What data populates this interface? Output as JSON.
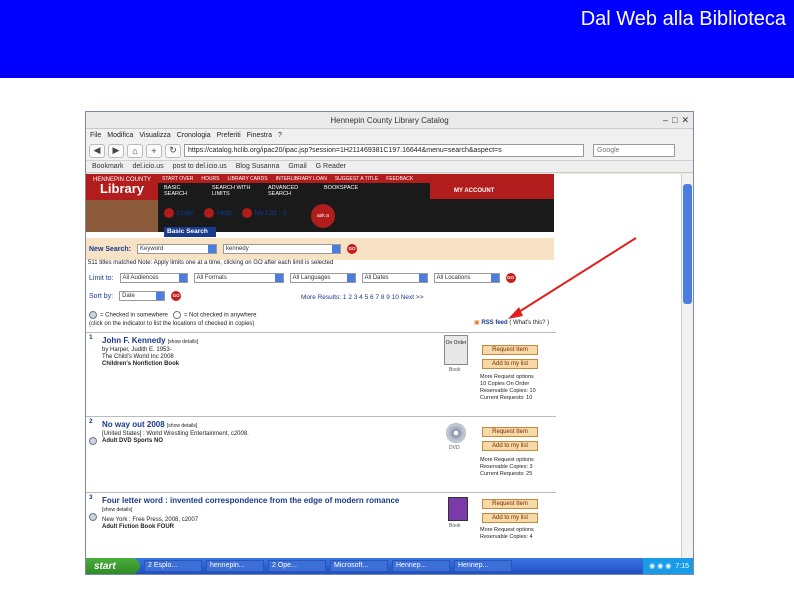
{
  "slide": {
    "title": "Dal Web alla Biblioteca"
  },
  "browser": {
    "window_title": "Hennepin County Library Catalog",
    "menu": [
      "File",
      "Modifica",
      "Visualizza",
      "Cronologia",
      "Preferiti",
      "Finestra",
      "?"
    ],
    "url": "https://catalog.hclib.org/ipac20/ipac.jsp?session=1H211469381C197.16644&menu=search&aspect=s",
    "search_placeholder": "Google",
    "bookmarks": [
      "Bookmark",
      "del.icio.us",
      "post to del.icio.us",
      "Blog Susanna",
      "Gmail",
      "G Reader"
    ]
  },
  "library": {
    "logo_top": "HENNEPIN COUNTY",
    "logo_name": "Library",
    "top_links": [
      "START OVER",
      "HOURS",
      "LIBRARY CARDS",
      "INTERLIBRARY LOAN",
      "SUGGEST A TITLE",
      "FEEDBACK"
    ],
    "main_nav": [
      "BASIC SEARCH",
      "SEARCH WITH LIMITS",
      "ADVANCED SEARCH",
      "BOOKSPACE"
    ],
    "account": "MY ACCOUNT",
    "login": "Login",
    "help": "Help",
    "mylist": "My List - 0",
    "ask": "ask a librarian",
    "basic_search": "Basic Search",
    "new_search_label": "New Search:",
    "search_type": "Keyword",
    "search_value": "kennedy",
    "go": "GO",
    "matched": "511 titles matched Note: Apply limits one at a time, clicking on GO after each limit is selected",
    "limit_label": "Limit to:",
    "limits": [
      "All Audiences",
      "All Formats",
      "All Languages",
      "All Dates",
      "All Locations"
    ],
    "sort_label": "Sort by:",
    "sort_value": "Date",
    "more_results": "More Results: 1 2 3 4 5 6 7 8 9 10 Next >>",
    "legend_1": "= Checked in somewhere",
    "legend_2": "= Not checked in anywhere",
    "legend_note": "(click on the indicator to list the locations of checked in copies)",
    "rss": "RSS feed",
    "rss_link": "( What's this? )"
  },
  "results": [
    {
      "num": "1",
      "title": "John F. Kennedy",
      "details": "[show details]",
      "meta": [
        "by Harper, Judith E. 1953-",
        "The Child's World Inc 2008"
      ],
      "collection": "Children's Nonfiction Book",
      "icon": "On Order",
      "icon_label": "Book",
      "request": "Request Item",
      "add": "Add to my list",
      "side": [
        "More Request options",
        "10 Copies On Order",
        "Reservable Copies: 10",
        "Current Requests: 10"
      ]
    },
    {
      "num": "2",
      "title": "No way out 2008",
      "details": "[show details]",
      "meta": [
        "[United States] : World Wrestling Entertainment, c2008."
      ],
      "collection": "Adult DVD Sports NO",
      "icon": "",
      "icon_label": "DVD",
      "request": "Request Item",
      "add": "Add to my list",
      "side": [
        "More Request options",
        "Reservable Copies: 3",
        "Current Requests: 25"
      ]
    },
    {
      "num": "3",
      "title": "Four letter word : invented correspondence from the edge of modern romance",
      "details": "[show details]",
      "meta": [
        "New York : Free Press, 2008, c2007"
      ],
      "collection": "Adult Fiction Book FOUR",
      "icon": "",
      "icon_label": "Book",
      "request": "Request Item",
      "add": "Add to my list",
      "side": [
        "More Request options",
        "Reservable Copies: 4"
      ]
    }
  ],
  "taskbar": {
    "start": "start",
    "items": [
      "2 Esplo...",
      "hennepin...",
      "2 Ope...",
      "Microsoft...",
      "Hennep...",
      "Hennep..."
    ],
    "clock": "7:15"
  },
  "colors": {
    "banner": "#0000ff",
    "library_red": "#b11c1c",
    "link_blue": "#1a3a8a",
    "arrow": "#e0201c"
  }
}
